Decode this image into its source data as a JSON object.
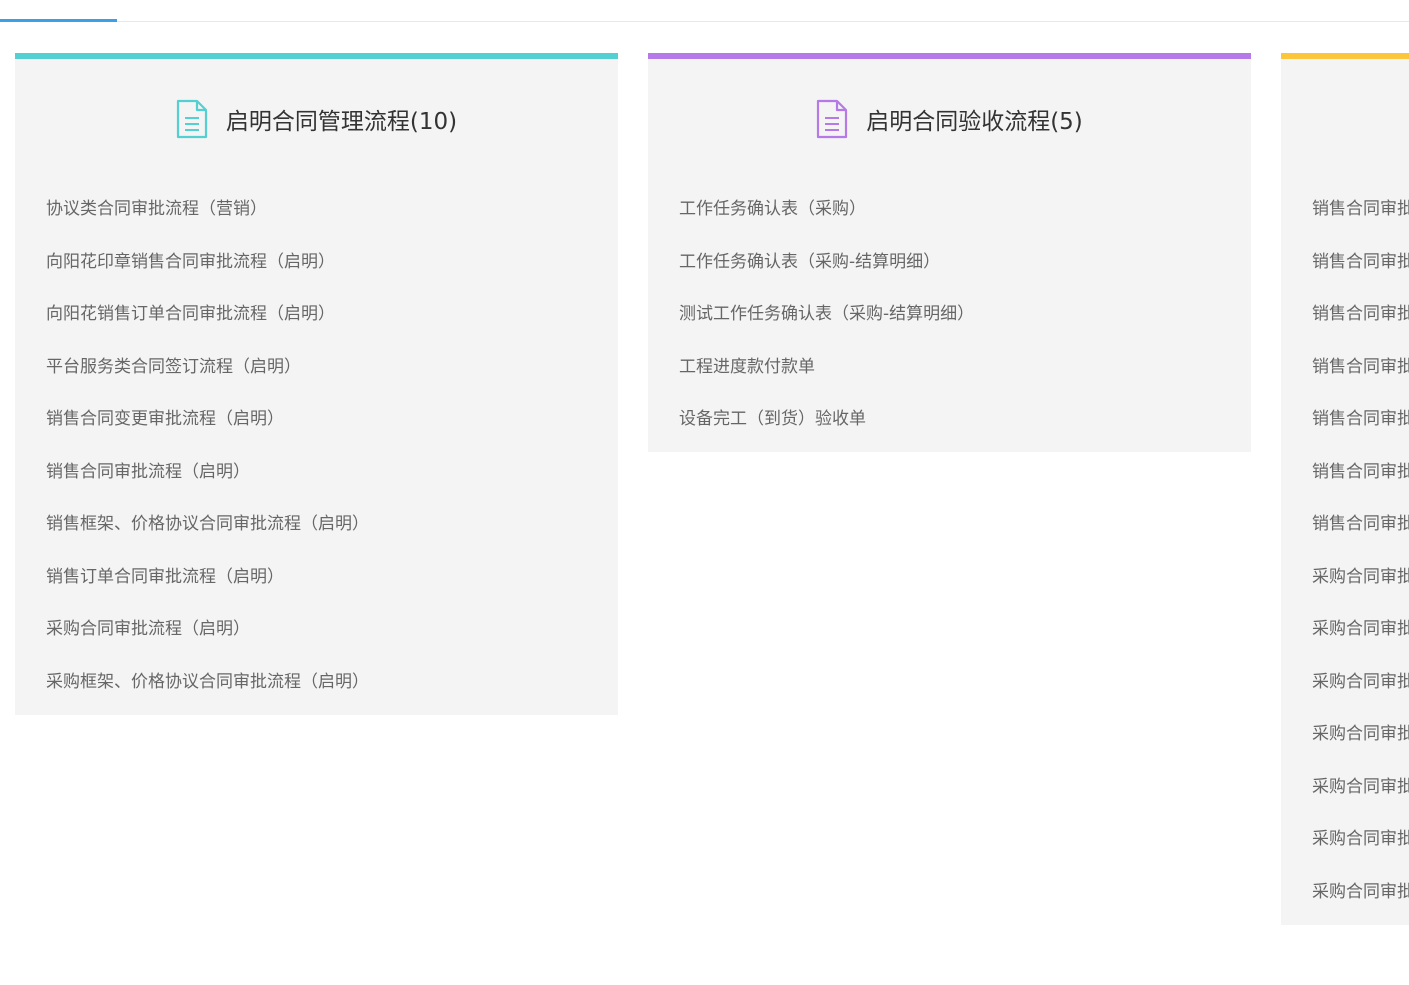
{
  "colors": {
    "tab_indicator": "#3aa0e8",
    "card1_accent": "#55d0d2",
    "card2_accent": "#b57ae8",
    "card3_accent": "#fbc63c",
    "card_bg": "#f4f4f4",
    "title_text": "#333333",
    "item_text": "#666666"
  },
  "cards": [
    {
      "title": "启明合同管理流程(10)",
      "icon": "document-icon",
      "items": [
        "协议类合同审批流程（营销）",
        "向阳花印章销售合同审批流程（启明）",
        "向阳花销售订单合同审批流程（启明）",
        "平台服务类合同签订流程（启明）",
        "销售合同变更审批流程（启明）",
        "销售合同审批流程（启明）",
        "销售框架、价格协议合同审批流程（启明）",
        "销售订单合同审批流程（启明）",
        "采购合同审批流程（启明）",
        "采购框架、价格协议合同审批流程（启明）"
      ]
    },
    {
      "title": "启明合同验收流程(5)",
      "icon": "document-icon",
      "items": [
        "工作任务确认表（采购）",
        "工作任务确认表（采购-结算明细）",
        "测试工作任务确认表（采购-结算明细）",
        "工程进度款付款单",
        "设备完工（到货）验收单"
      ]
    },
    {
      "title": "",
      "icon": "",
      "items": [
        "销售合同审批",
        "销售合同审批",
        "销售合同审批",
        "销售合同审批",
        "销售合同审批",
        "销售合同审批",
        "销售合同审批",
        "采购合同审批",
        "采购合同审批",
        "采购合同审批",
        "采购合同审批",
        "采购合同审批",
        "采购合同审批",
        "采购合同审批"
      ]
    }
  ]
}
